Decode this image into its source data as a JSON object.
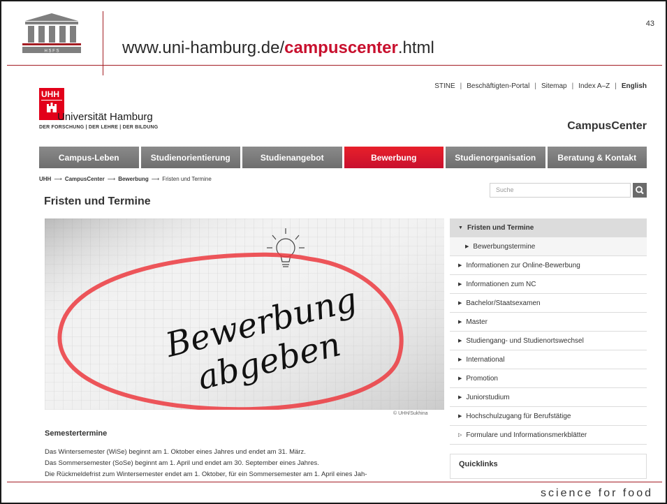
{
  "slide": {
    "url_prefix": "www.uni-hamburg.de/",
    "url_highlight": "campuscenter",
    "url_suffix": ".html",
    "page_number": "43",
    "logo_text": "H S F S",
    "tagline": "science for food",
    "accent_color": "#a31c22"
  },
  "web": {
    "top_nav": [
      "STINE",
      "Beschäftigten-Portal",
      "Sitemap",
      "Index A–Z",
      "English"
    ],
    "university": {
      "logo_text": "UHH",
      "name": "Universität Hamburg",
      "motto": "DER FORSCHUNG | DER LEHRE | DER BILDUNG"
    },
    "site_name": "CampusCenter",
    "main_nav": [
      {
        "label": "Campus-Leben",
        "active": false
      },
      {
        "label": "Studienorientierung",
        "active": false
      },
      {
        "label": "Studienangebot",
        "active": false
      },
      {
        "label": "Bewerbung",
        "active": true
      },
      {
        "label": "Studienorganisation",
        "active": false
      },
      {
        "label": "Beratung & Kontakt",
        "active": false
      }
    ],
    "breadcrumb": [
      "UHH",
      "CampusCenter",
      "Bewerbung",
      "Fristen und Termine"
    ],
    "search_placeholder": "Suche",
    "page_title": "Fristen und Termine",
    "hero": {
      "handwriting_line1": "Bewerbung",
      "handwriting_line2": "abgeben",
      "credit": "© UHH/Sukhina"
    },
    "section_title": "Semestertermine",
    "paragraphs": [
      "Das Wintersemester (WiSe) beginnt am 1. Oktober eines Jahres und endet am 31. März.",
      "Das Sommersemester (SoSe) beginnt am 1. April und endet am 30. September eines Jahres.",
      "Die Rückmeldefrist zum Wintersemester endet am 1. Oktober, für ein Sommersemester am 1. April eines Jah-"
    ],
    "side_nav": [
      {
        "label": "Fristen und Termine",
        "kind": "head"
      },
      {
        "label": "Bewerbungstermine",
        "kind": "sub"
      },
      {
        "label": "Informationen zur Online-Bewerbung",
        "kind": "item"
      },
      {
        "label": "Informationen zum NC",
        "kind": "item"
      },
      {
        "label": "Bachelor/Staatsexamen",
        "kind": "item"
      },
      {
        "label": "Master",
        "kind": "item"
      },
      {
        "label": "Studiengang- und Studienortswechsel",
        "kind": "item"
      },
      {
        "label": "International",
        "kind": "item"
      },
      {
        "label": "Promotion",
        "kind": "item"
      },
      {
        "label": "Juniorstudium",
        "kind": "item"
      },
      {
        "label": "Hochschulzugang für Berufstätige",
        "kind": "item"
      },
      {
        "label": "Formulare und Informationsmerkblätter",
        "kind": "item"
      }
    ],
    "quicklinks_title": "Quicklinks",
    "brand_red": "#e2001a"
  }
}
